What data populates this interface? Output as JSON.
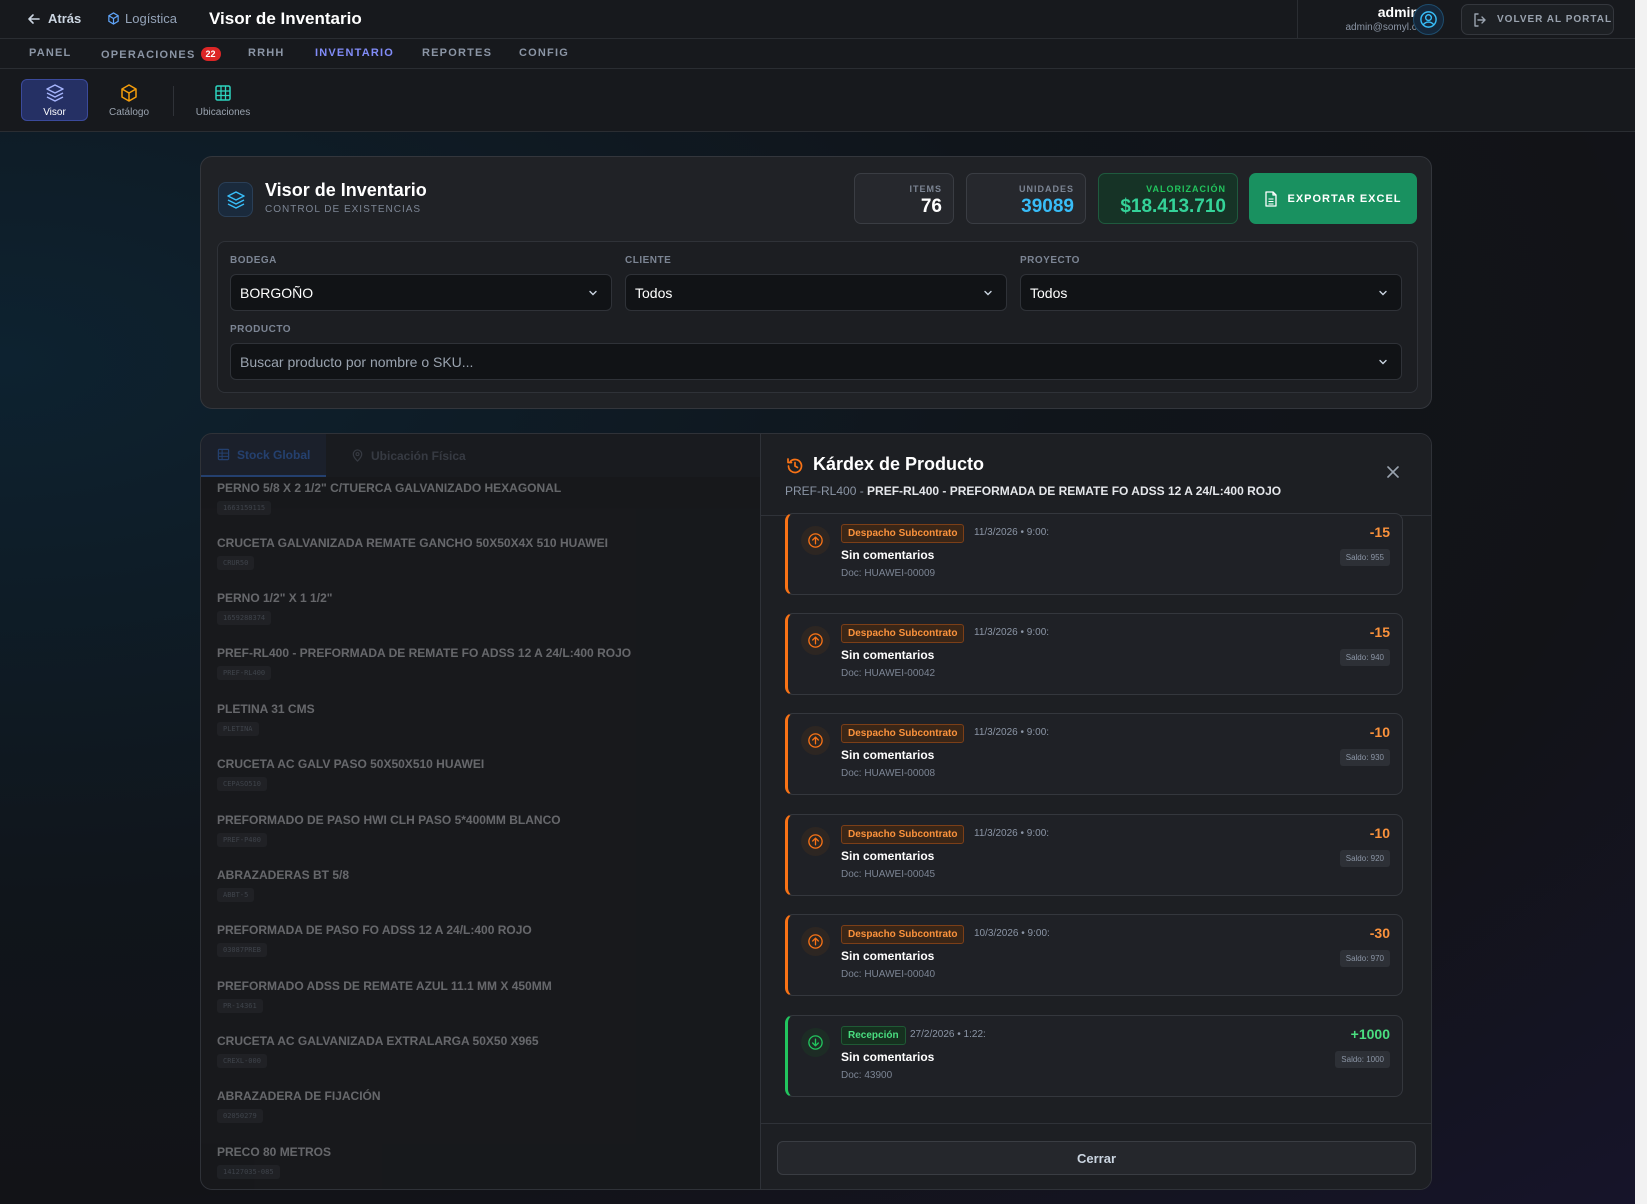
{
  "topbar": {
    "back_label": "Atrás",
    "breadcrumb": "Logística",
    "page_title": "Visor de Inventario",
    "user_name": "admin",
    "user_email": "admin@somyl.cl",
    "portal_button": "VOLVER AL PORTAL"
  },
  "nav": {
    "tabs": [
      {
        "label": "PANEL"
      },
      {
        "label": "OPERACIONES",
        "badge": "22"
      },
      {
        "label": "RRHH"
      },
      {
        "label": "INVENTARIO",
        "active": true
      },
      {
        "label": "REPORTES"
      },
      {
        "label": "CONFIG"
      }
    ]
  },
  "subnav": {
    "items": [
      {
        "label": "Visor",
        "icon": "layers-icon",
        "active": true
      },
      {
        "label": "Catálogo",
        "icon": "box-icon"
      },
      {
        "label": "Ubicaciones",
        "icon": "grid-icon"
      }
    ]
  },
  "header": {
    "title": "Visor de Inventario",
    "subtitle": "CONTROL DE EXISTENCIAS",
    "stats": {
      "items_label": "ITEMS",
      "items_value": "76",
      "units_label": "UNIDADES",
      "units_value": "39089",
      "valuation_label": "VALORIZACIÓN",
      "valuation_value": "$18.413.710"
    },
    "export_label": "EXPORTAR EXCEL"
  },
  "filters": {
    "bodega_label": "BODEGA",
    "bodega_value": "BORGOÑO",
    "cliente_label": "CLIENTE",
    "cliente_value": "Todos",
    "proyecto_label": "PROYECTO",
    "proyecto_value": "Todos",
    "producto_label": "PRODUCTO",
    "producto_placeholder": "Buscar producto por nombre o SKU..."
  },
  "stock": {
    "tabs": [
      "Stock Global",
      "Ubicación Física"
    ],
    "products": [
      {
        "name": "PERNO 5/8 X 2 1/2\" C/TUERCA GALVANIZADO HEXAGONAL",
        "sku": "1663159115"
      },
      {
        "name": "CRUCETA GALVANIZADA REMATE GANCHO 50X50X4X 510 HUAWEI",
        "sku": "CRUR50"
      },
      {
        "name": "PERNO 1/2\" X 1 1/2\"",
        "sku": "1659288374"
      },
      {
        "name": "PREF-RL400 - PREFORMADA DE REMATE FO ADSS 12 A 24/L:400 ROJO",
        "sku": "PREF-RL400"
      },
      {
        "name": "PLETINA 31 CMS",
        "sku": "PLETINA"
      },
      {
        "name": "CRUCETA AC GALV PASO 50X50X510 HUAWEI",
        "sku": "CEPASO510"
      },
      {
        "name": "PREFORMADO DE PASO HWI CLH PASO 5*400MM BLANCO",
        "sku": "PREF-P400"
      },
      {
        "name": "ABRAZADERAS BT 5/8",
        "sku": "ABBT-5"
      },
      {
        "name": "PREFORMADA DE PASO FO ADSS 12 A 24/L:400 ROJO",
        "sku": "03087PREB"
      },
      {
        "name": "PREFORMADO ADSS DE REMATE AZUL 11.1 MM X 450MM",
        "sku": "PR-14361"
      },
      {
        "name": "CRUCETA AC GALVANIZADA EXTRALARGA 50X50 X965",
        "sku": "CREXL-000"
      },
      {
        "name": "ABRAZADERA DE FIJACIÓN",
        "sku": "02050279"
      },
      {
        "name": "PRECO 80 METROS",
        "sku": "14127035-085"
      }
    ]
  },
  "kardex": {
    "title": "Kárdex de Producto",
    "sku": "PREF-RL400",
    "product_name": "PREF-RL400 - PREFORMADA DE REMATE FO ADSS 12 A 24/L:400 ROJO",
    "close_label": "Cerrar",
    "movements": [
      {
        "type": "Despacho Subcontrato",
        "date": "11/3/2026 • 9:00:",
        "comment": "Sin comentarios",
        "doc": "Doc: HUAWEI-00009",
        "qty": "-15",
        "balance": "Saldo: 955",
        "direction": "out"
      },
      {
        "type": "Despacho Subcontrato",
        "date": "11/3/2026 • 9:00:",
        "comment": "Sin comentarios",
        "doc": "Doc: HUAWEI-00042",
        "qty": "-15",
        "balance": "Saldo: 940",
        "direction": "out"
      },
      {
        "type": "Despacho Subcontrato",
        "date": "11/3/2026 • 9:00:",
        "comment": "Sin comentarios",
        "doc": "Doc: HUAWEI-00008",
        "qty": "-10",
        "balance": "Saldo: 930",
        "direction": "out"
      },
      {
        "type": "Despacho Subcontrato",
        "date": "11/3/2026 • 9:00:",
        "comment": "Sin comentarios",
        "doc": "Doc: HUAWEI-00045",
        "qty": "-10",
        "balance": "Saldo: 920",
        "direction": "out"
      },
      {
        "type": "Despacho Subcontrato",
        "date": "10/3/2026 • 9:00:",
        "comment": "Sin comentarios",
        "doc": "Doc: HUAWEI-00040",
        "qty": "-30",
        "balance": "Saldo: 970",
        "direction": "out"
      },
      {
        "type": "Recepción",
        "date": "27/2/2026 • 1:22:",
        "comment": "Sin comentarios",
        "doc": "Doc: 43900",
        "qty": "+1000",
        "balance": "Saldo: 1000",
        "direction": "in"
      }
    ]
  },
  "colors": {
    "accent": "#818cf8",
    "success": "#199160",
    "out": "#f97316",
    "in": "#22c55e",
    "info": "#3b82f6"
  }
}
